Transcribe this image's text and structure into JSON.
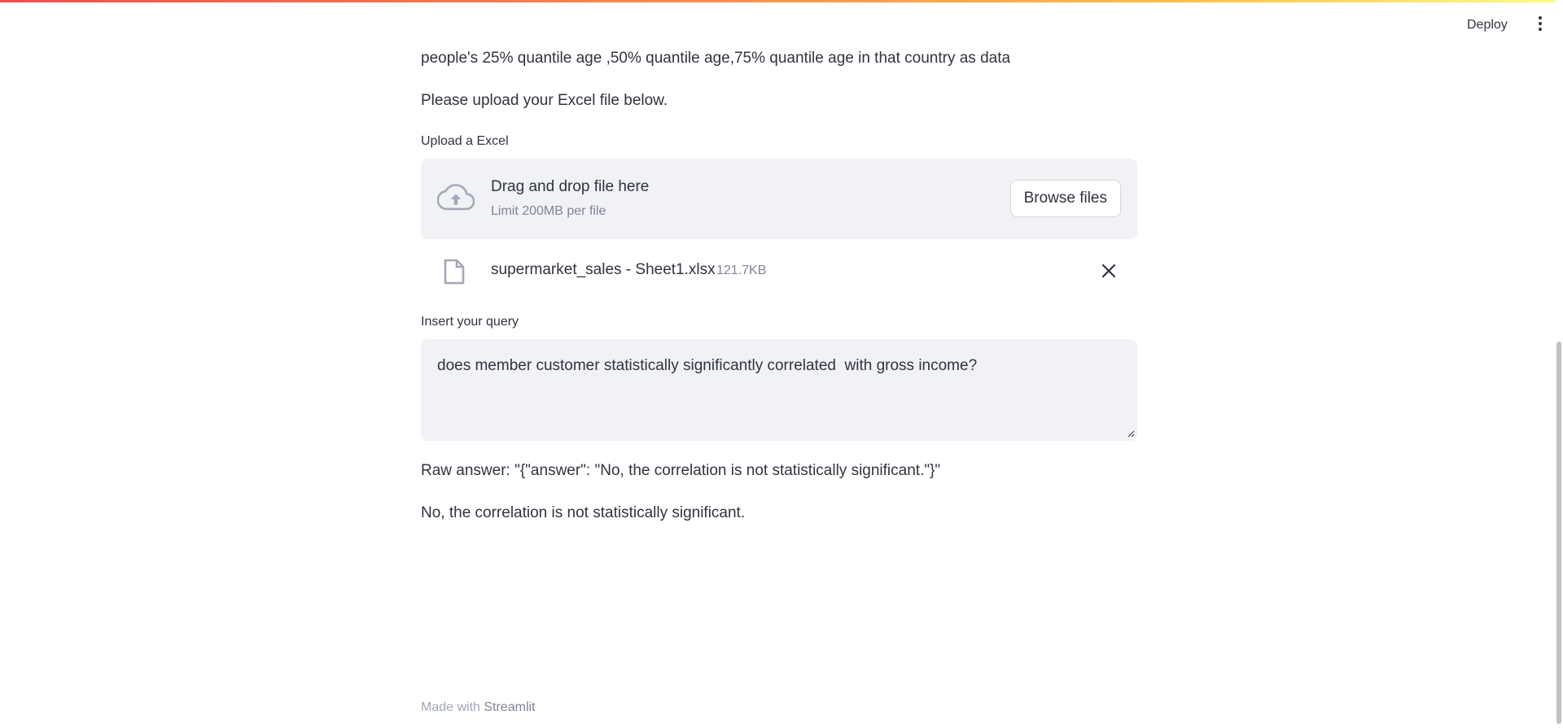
{
  "header": {
    "deploy_label": "Deploy",
    "menu_icon": "more-vertical-icon"
  },
  "main": {
    "intro_line": "people's 25% quantile age ,50% quantile age,75% quantile age in that country as data",
    "upload_prompt": "Please upload your Excel file below."
  },
  "uploader": {
    "label": "Upload a Excel",
    "dropzone_title": "Drag and drop file here",
    "dropzone_limit": "Limit 200MB per file",
    "browse_label": "Browse files",
    "upload_icon": "cloud-upload-icon",
    "file": {
      "name": "supermarket_sales - Sheet1.xlsx",
      "size": "121.7KB",
      "icon": "file-icon",
      "remove_icon": "close-icon"
    }
  },
  "query": {
    "label": "Insert your query",
    "value": "does member customer statistically significantly correlated  with gross income?"
  },
  "result": {
    "raw_answer": "Raw answer: \"{\"answer\": \"No, the correlation is not statistically significant.\"}\"",
    "answer": "No, the correlation is not statistically significant."
  },
  "footer": {
    "prefix": "Made with ",
    "brand": "Streamlit"
  },
  "colors": {
    "text": "#31333f",
    "muted": "#808495",
    "panel_bg": "#f0f2f6",
    "accent_gradient_start": "#ff4b4b",
    "accent_gradient_end": "#fffd80"
  }
}
